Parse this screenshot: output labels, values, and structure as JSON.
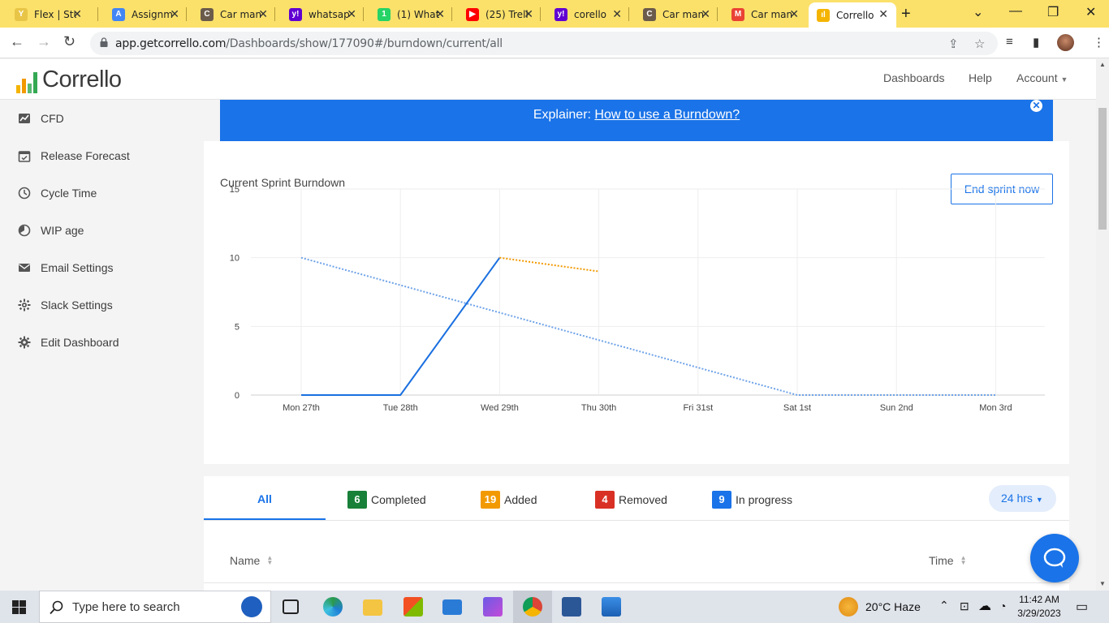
{
  "browser": {
    "tabs": [
      {
        "title": "Flex | Stu",
        "favicon_color": "#e8c547",
        "favicon_text": "Y"
      },
      {
        "title": "Assignm",
        "favicon_color": "#4285f4",
        "favicon_text": "A"
      },
      {
        "title": "Car man",
        "favicon_color": "#6b5b4b",
        "favicon_text": "C"
      },
      {
        "title": "whatsap",
        "favicon_color": "#6001d2",
        "favicon_text": "y!"
      },
      {
        "title": "(1) What",
        "favicon_color": "#25d366",
        "favicon_text": "1"
      },
      {
        "title": "(25) Trell",
        "favicon_color": "#ff0000",
        "favicon_text": "▶"
      },
      {
        "title": "corello",
        "favicon_color": "#6001d2",
        "favicon_text": "y!"
      },
      {
        "title": "Car man",
        "favicon_color": "#6b5b4b",
        "favicon_text": "C"
      },
      {
        "title": "Car man",
        "favicon_color": "#ea4335",
        "favicon_text": "M"
      },
      {
        "title": "Corrello",
        "favicon_color": "#f4b400",
        "favicon_text": "ıl"
      }
    ],
    "url_host": "app.getcorrello.com",
    "url_path": "/Dashboards/show/177090#/burndown/current/all"
  },
  "app": {
    "logo_text": "Corrello",
    "nav": {
      "dashboards": "Dashboards",
      "help": "Help",
      "account": "Account"
    },
    "sidebar": [
      {
        "label": "CFD",
        "icon": "chart-icon"
      },
      {
        "label": "Release Forecast",
        "icon": "calendar-icon"
      },
      {
        "label": "Cycle Time",
        "icon": "clock-icon"
      },
      {
        "label": "WIP age",
        "icon": "timer-icon"
      },
      {
        "label": "Email Settings",
        "icon": "mail-icon"
      },
      {
        "label": "Slack Settings",
        "icon": "slack-icon"
      },
      {
        "label": "Edit Dashboard",
        "icon": "gear-icon"
      }
    ],
    "explainer": {
      "prefix": "Explainer: ",
      "link": "How to use a Burndown?"
    },
    "chart_title": "Current Sprint Burndown",
    "end_sprint_button": "End sprint now",
    "filters": {
      "all": "All",
      "completed": {
        "count": "6",
        "label": "Completed",
        "color": "#188038"
      },
      "added": {
        "count": "19",
        "label": "Added",
        "color": "#f29900"
      },
      "removed": {
        "count": "4",
        "label": "Removed",
        "color": "#d93025"
      },
      "in_progress": {
        "count": "9",
        "label": "In progress",
        "color": "#1a73e8"
      }
    },
    "period": "24 hrs",
    "table_headers": {
      "name": "Name",
      "time": "Time"
    }
  },
  "chart_data": {
    "type": "line",
    "categories": [
      "Mon 27th",
      "Tue 28th",
      "Wed 29th",
      "Thu 30th",
      "Fri 31st",
      "Sat 1st",
      "Sun 2nd",
      "Mon 3rd"
    ],
    "ylim": [
      0,
      15
    ],
    "yticks": [
      "0",
      "5",
      "10",
      "15"
    ],
    "grid": true,
    "series": [
      {
        "style": "dotted",
        "color": "#6fa3e8",
        "values": [
          10,
          8,
          6,
          4,
          2,
          0,
          0,
          0
        ]
      },
      {
        "style": "solid",
        "color": "#1a6fe0",
        "values": [
          0,
          0,
          10,
          null,
          null,
          null,
          null,
          null
        ]
      },
      {
        "style": "dotted",
        "color": "#f29900",
        "values": [
          null,
          null,
          10,
          9,
          null,
          null,
          null,
          null
        ]
      }
    ]
  },
  "taskbar": {
    "search_placeholder": "Type here to search",
    "weather": "20°C  Haze",
    "time": "11:42 AM",
    "date": "3/29/2023"
  }
}
